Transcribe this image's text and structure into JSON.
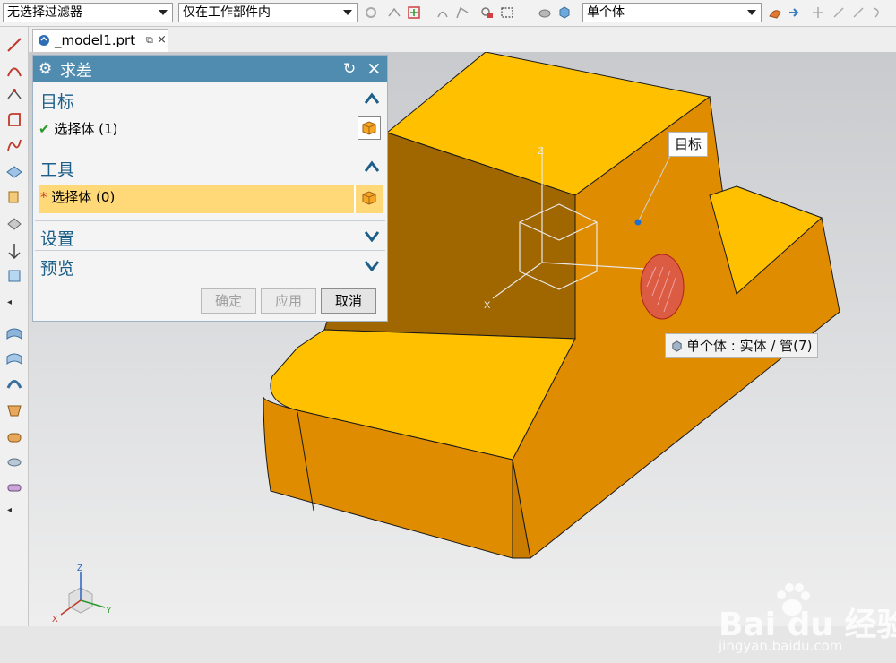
{
  "toolbar": {
    "filter_combo": "无选择过滤器",
    "scope_combo": "仅在工作部件内",
    "body_combo": "单个体"
  },
  "tab": {
    "label": "_model1.prt"
  },
  "dialog": {
    "title": "求差",
    "target": {
      "header": "目标",
      "select_label": "选择体 (1)"
    },
    "tool": {
      "header": "工具",
      "select_label": "选择体 (0)"
    },
    "settings": {
      "header": "设置"
    },
    "preview": {
      "header": "预览"
    },
    "buttons": {
      "ok": "确定",
      "apply": "应用",
      "cancel": "取消"
    }
  },
  "viewport": {
    "target_tooltip": "目标",
    "body_tooltip": "单个体 : 实体 / 管(7)",
    "axes": {
      "x": "X",
      "y": "Y",
      "z": "Z"
    }
  },
  "watermark": {
    "brand": "Bai du 经验",
    "url": "jingyan.baidu.com"
  },
  "colors": {
    "part_top": "#ffc000",
    "part_side": "#e08c00",
    "dialog_header": "#4f8cb0",
    "highlight_row": "#ffd878"
  }
}
